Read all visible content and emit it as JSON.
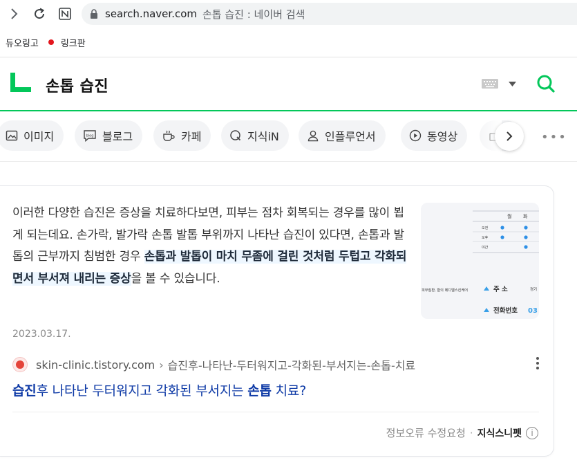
{
  "browser": {
    "url_domain": "search.naver.com",
    "tab_title": "손톱 습진 : 네이버 검색",
    "bookmarks": [
      {
        "label": "듀오링고"
      },
      {
        "label": "링크판"
      }
    ]
  },
  "search": {
    "query": "손톱 습진",
    "brand_color": "#03c75a"
  },
  "tabs": [
    {
      "label": "이미지",
      "icon": "image-icon"
    },
    {
      "label": "블로그",
      "icon": "blog-icon"
    },
    {
      "label": "카페",
      "icon": "cafe-cup-icon"
    },
    {
      "label": "지식iN",
      "icon": "knowledge-q-icon"
    },
    {
      "label": "인플루언서",
      "icon": "person-icon"
    },
    {
      "label": "동영상",
      "icon": "play-circle-icon"
    },
    {
      "label": "",
      "icon": "shopping-bag-icon"
    }
  ],
  "result": {
    "snippet_lead": "이러한 다양한 습진은 증상을 치료하다보면, 피부는 점차 회복되는 경우를 많이 뵙게 되는데요. 손가락, 발가락 손톱 발톱 부위까지 나타난 습진이 있다면, 손톱과 발톱의 근부까지 침범한 경우 ",
    "snippet_highlight": "손톱과 발톱이 마치 무좀에 걸린 것처럼 두텁고 각화되면서 부서져 내리는 증상",
    "snippet_tail": "을 볼 수 있습니다.",
    "date": "2023.03.17.",
    "source_domain": "skin-clinic.tistory.com",
    "source_sep": "›",
    "source_path": "습진후-나타난-두터워지고-각화된-부서지는-손톱-치료",
    "title_parts": [
      {
        "text": "습진",
        "bold": true
      },
      {
        "text": "후 나타난 두터워지고 각화된 부서지는 ",
        "bold": false
      },
      {
        "text": "손톱",
        "bold": true
      },
      {
        "text": " 치료?",
        "bold": false
      }
    ],
    "thumbnail": {
      "table_header": [
        "월",
        "화"
      ],
      "rows": [
        "오전",
        "오후",
        "야간"
      ],
      "clinic_text": "피부질환, 함의 메디엘스킨케어",
      "addr_label": "주    소",
      "addr_value": "경기",
      "phone_label": "전화번호",
      "phone_value": "03"
    },
    "footer": {
      "report_label": "정보오류 수정요청",
      "dot": "·",
      "brand": "지식스니펫",
      "info": "i"
    }
  }
}
